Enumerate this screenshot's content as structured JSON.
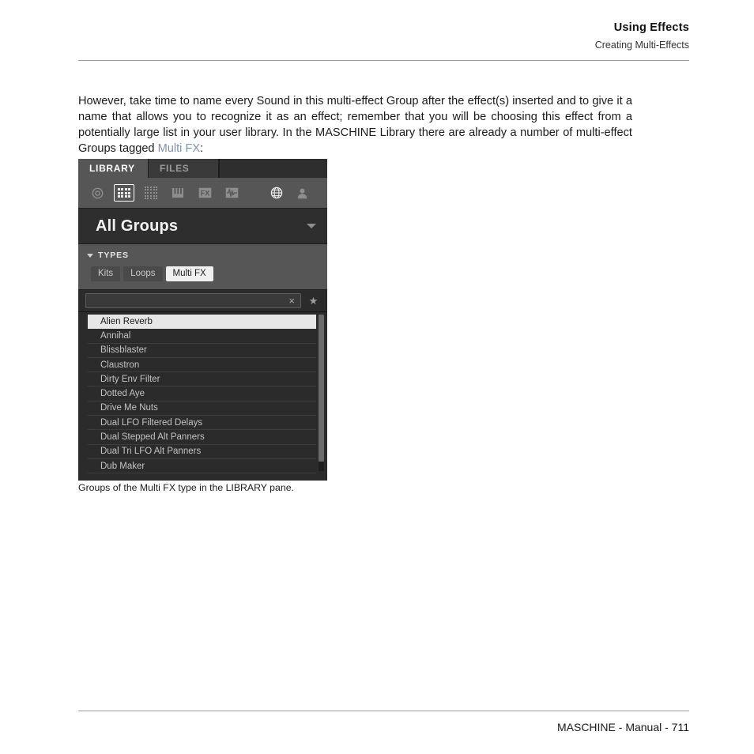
{
  "header": {
    "title": "Using Effects",
    "subtitle": "Creating Multi-Effects"
  },
  "body": {
    "part1": "However, take time to name every Sound in this multi-effect Group after the effect(s) inserted and to give it a name that allows you to recognize it as an effect; remember that you will be choosing this effect from a potentially large list in your user library. In the MASCHINE Library there are already a number of multi-effect Groups tagged ",
    "link": "Multi FX",
    "part2": ":",
    "link_color": "#7c92aa"
  },
  "figure": {
    "tabs": [
      {
        "label": "LIBRARY",
        "active": true
      },
      {
        "label": "FILES",
        "active": false
      }
    ],
    "icons": [
      {
        "name": "disc-icon",
        "selected": false
      },
      {
        "name": "groups-grid-icon",
        "selected": true
      },
      {
        "name": "dot-matrix-icon",
        "selected": false
      },
      {
        "name": "piano-keys-icon",
        "selected": false
      },
      {
        "name": "fx-icon",
        "label": "FX",
        "selected": false
      },
      {
        "name": "waveform-icon",
        "selected": false
      },
      {
        "name": "globe-icon",
        "selected": true
      },
      {
        "name": "user-icon",
        "selected": false
      }
    ],
    "group_header": {
      "title": "All Groups",
      "dropdown_icon": "chevron-down-icon"
    },
    "types": {
      "label": "TYPES",
      "collapse_icon": "triangle-down-icon",
      "tags": [
        {
          "label": "Kits",
          "selected": false
        },
        {
          "label": "Loops",
          "selected": false
        },
        {
          "label": "Multi FX",
          "selected": true
        }
      ]
    },
    "search": {
      "value": "",
      "placeholder": "",
      "clear_icon": "close-icon",
      "favorite_icon": "star-icon"
    },
    "results": [
      {
        "label": "Alien Reverb",
        "selected": true
      },
      {
        "label": "Annihal",
        "selected": false
      },
      {
        "label": "Blissblaster",
        "selected": false
      },
      {
        "label": "Claustron",
        "selected": false
      },
      {
        "label": "Dirty Env Filter",
        "selected": false
      },
      {
        "label": "Dotted Aye",
        "selected": false
      },
      {
        "label": "Drive Me Nuts",
        "selected": false
      },
      {
        "label": "Dual LFO Filtered Delays",
        "selected": false
      },
      {
        "label": "Dual Stepped Alt Panners",
        "selected": false
      },
      {
        "label": "Dual Tri LFO Alt Panners",
        "selected": false
      },
      {
        "label": "Dub Maker",
        "selected": false
      }
    ]
  },
  "caption": "Groups of the Multi FX type in the LIBRARY pane.",
  "footer": "MASCHINE - Manual - 711"
}
